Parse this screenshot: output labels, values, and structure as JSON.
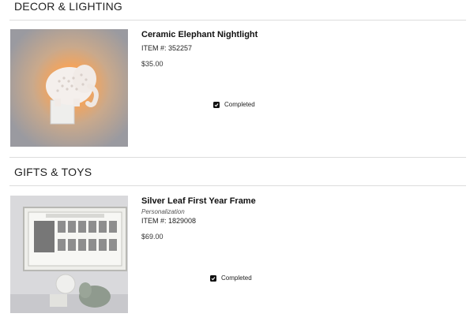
{
  "sections": [
    {
      "title": "DECOR & LIGHTING",
      "items": [
        {
          "name": "Ceramic Elephant Nightlight",
          "personalization": "",
          "item_number": "ITEM #: 352257",
          "price": "$35.00",
          "status": "Completed",
          "image": "elephant-nightlight-photo"
        }
      ]
    },
    {
      "title": "GIFTS & TOYS",
      "items": [
        {
          "name": "Silver Leaf First Year Frame",
          "personalization": "Personalization",
          "item_number": "ITEM #: 1829008",
          "price": "$69.00",
          "status": "Completed",
          "image": "first-year-frame-photo"
        }
      ]
    }
  ],
  "icons": {
    "status_checkbox": "checkbox-checked-icon"
  }
}
